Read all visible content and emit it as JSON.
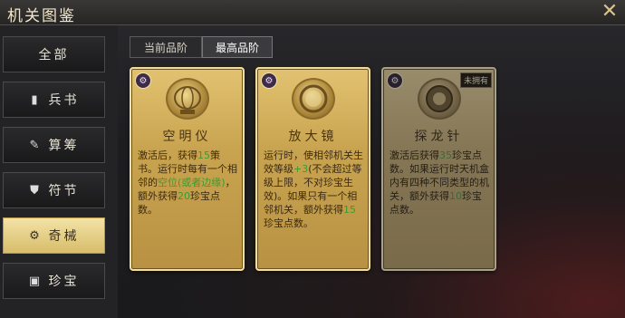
{
  "window": {
    "title": "机关图鉴",
    "close_icon": "close-x-icon"
  },
  "sidebar": {
    "items": [
      {
        "label": "全部",
        "icon": "",
        "active": false
      },
      {
        "label": "兵书",
        "icon": "book-icon",
        "active": false
      },
      {
        "label": "算筹",
        "icon": "abacus-icon",
        "active": false
      },
      {
        "label": "符节",
        "icon": "shield-tally-icon",
        "active": false
      },
      {
        "label": "奇械",
        "icon": "gear-mechanism-icon",
        "active": true
      },
      {
        "label": "珍宝",
        "icon": "treasure-chest-icon",
        "active": false
      }
    ]
  },
  "tabs": [
    {
      "label": "当前品阶",
      "active": false
    },
    {
      "label": "最高品阶",
      "active": true
    }
  ],
  "cards": [
    {
      "name": "空明仪",
      "badge_icon": "mechanism-badge-icon",
      "emblem_icon": "armillary-sphere-icon",
      "owned": true,
      "desc_parts": [
        "激活后，获得",
        "15",
        "策书。运行时每有一个相邻的",
        "空位(或者边缘)",
        "，额外获得",
        "20",
        "珍宝点数。"
      ]
    },
    {
      "name": "放大镜",
      "badge_icon": "mechanism-badge-icon",
      "emblem_icon": "magnifying-glass-icon",
      "owned": true,
      "desc_parts": [
        "运行时，使相邻机关生效等级",
        "+3",
        "(不会超过等级上限，不对珍宝生效)。如果只有一个相邻机关，额外获得",
        "15",
        "珍宝点数。"
      ]
    },
    {
      "name": "探龙针",
      "badge_icon": "mechanism-badge-icon",
      "emblem_icon": "compass-needle-icon",
      "owned": false,
      "status_label": "未拥有",
      "desc_parts": [
        "激活后获得",
        "35",
        "珍宝点数。如果运行时天机盒内有四种不同类型的机关，额外获得",
        "10",
        "珍宝点数。"
      ]
    }
  ]
}
